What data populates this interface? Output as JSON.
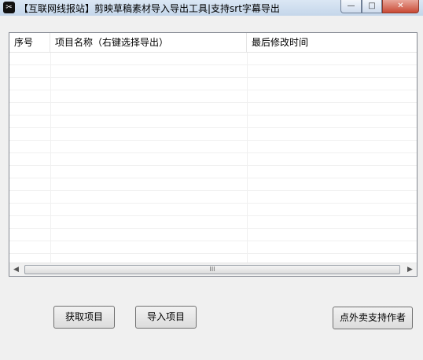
{
  "window": {
    "title": "【互联网线报站】剪映草稿素材导入导出工具|支持srt字幕导出",
    "controls": {
      "minimize": "—",
      "maximize": "□",
      "close": "✕"
    }
  },
  "list": {
    "columns": [
      "序号",
      "项目名称（右键选择导出）",
      "最后修改时间"
    ],
    "rows": [],
    "scrollbar": {
      "thumb_grip": "III"
    }
  },
  "buttons": {
    "get_projects": "获取项目",
    "import_project": "导入项目",
    "support_author": "点外卖支持作者"
  }
}
